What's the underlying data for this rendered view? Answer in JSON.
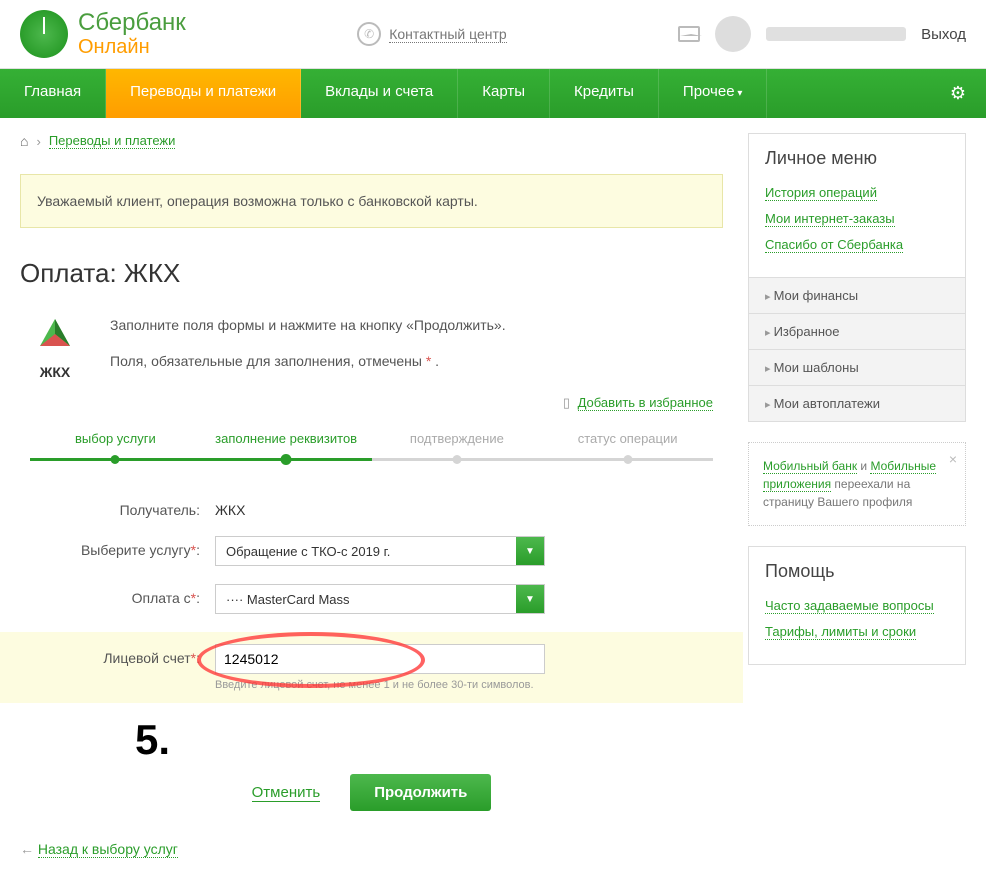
{
  "header": {
    "logo_name": "Сбербанк",
    "logo_sub": "Онлайн",
    "contact": "Контактный центр",
    "logout": "Выход"
  },
  "nav": {
    "items": [
      "Главная",
      "Переводы и платежи",
      "Вклады и счета",
      "Карты",
      "Кредиты",
      "Прочее"
    ],
    "active_index": 1
  },
  "breadcrumb": {
    "link": "Переводы и платежи"
  },
  "info_box": "Уважаемый клиент, операция возможна только с банковской карты.",
  "page_title": "Оплата: ЖКХ",
  "intro": {
    "icon_label": "ЖКХ",
    "line1": "Заполните поля формы и нажмите на кнопку «Продолжить».",
    "line2_prefix": "Поля, обязательные для заполнения, отмечены ",
    "line2_suffix": " ."
  },
  "add_favorite": "Добавить в избранное",
  "steps": [
    "выбор услуги",
    "заполнение реквизитов",
    "подтверждение",
    "статус операции"
  ],
  "form": {
    "recipient_label": "Получатель:",
    "recipient_value": "ЖКХ",
    "service_label": "Выберите услугу",
    "service_value": "Обращение с ТКО-с 2019 г.",
    "pay_from_label": "Оплата с",
    "pay_from_value": "···· MasterCard Mass",
    "account_label": "Лицевой счет",
    "account_value": "1245012",
    "account_hint": "Введите лицевой счет, не менее 1 и не более 30-ти символов."
  },
  "annotation": "5.",
  "buttons": {
    "cancel": "Отменить",
    "continue": "Продолжить"
  },
  "back_link": "Назад к выбору услуг",
  "sidebar": {
    "personal_title": "Личное меню",
    "personal_links": [
      "История операций",
      "Мои интернет-заказы",
      "Спасибо от Сбербанка"
    ],
    "acc_items": [
      "Мои финансы",
      "Избранное",
      "Мои шаблоны",
      "Мои автоплатежи"
    ],
    "notice_link1": "Мобильный банк",
    "notice_and": " и ",
    "notice_link2": "Мобильные приложения",
    "notice_text": " переехали на страницу Вашего профиля",
    "help_title": "Помощь",
    "help_links": [
      "Часто задаваемые вопросы",
      "Тарифы, лимиты и сроки"
    ]
  }
}
